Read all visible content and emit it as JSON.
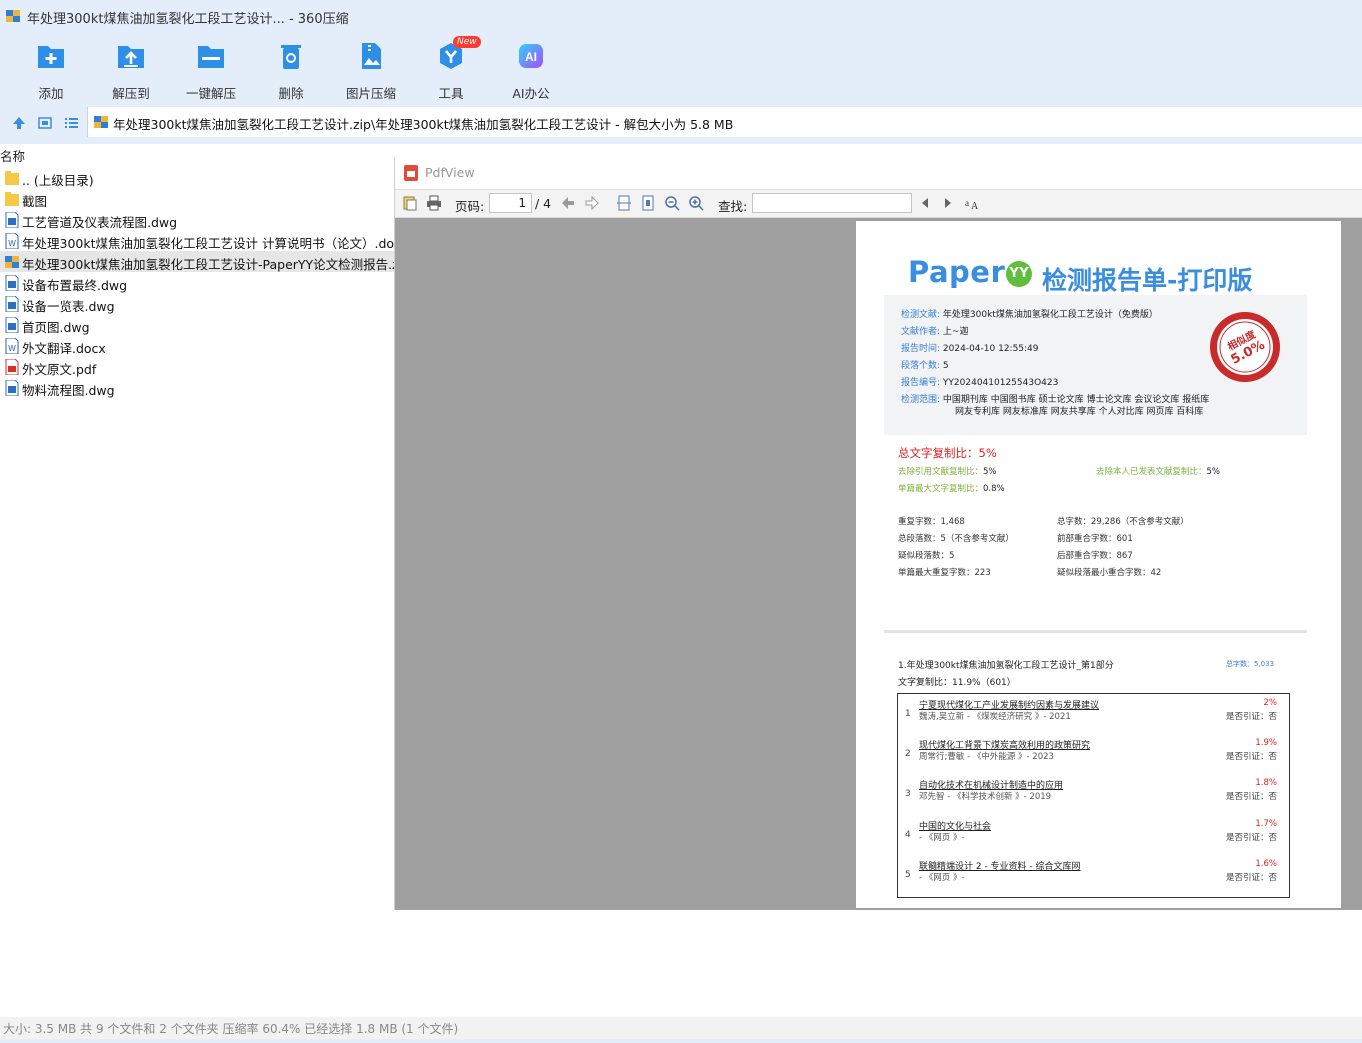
{
  "window": {
    "title": "年处理300kt煤焦油加氢裂化工段工艺设计... - 360压缩"
  },
  "toolbar": {
    "items": [
      {
        "label": "添加",
        "icon": "add-icon"
      },
      {
        "label": "解压到",
        "icon": "extract-to-icon"
      },
      {
        "label": "一键解压",
        "icon": "one-click-extract-icon"
      },
      {
        "label": "删除",
        "icon": "delete-icon"
      },
      {
        "label": "图片压缩",
        "icon": "image-compress-icon"
      },
      {
        "label": "工具",
        "icon": "tools-icon",
        "badge": "New"
      },
      {
        "label": "AI办公",
        "icon": "ai-office-icon"
      }
    ]
  },
  "address": {
    "path": "年处理300kt煤焦油加氢裂化工段工艺设计.zip\\年处理300kt煤焦油加氢裂化工段工艺设计 - 解包大小为 5.8 MB"
  },
  "filelist": {
    "column_name": "名称",
    "files": [
      {
        "name": ".. (上级目录)",
        "type": "folder"
      },
      {
        "name": "截图",
        "type": "folder"
      },
      {
        "name": "工艺管道及仪表流程图.dwg",
        "type": "dwg"
      },
      {
        "name": "年处理300kt煤焦油加氢裂化工段工艺设计 计算说明书（论文）.doc",
        "type": "doc"
      },
      {
        "name": "年处理300kt煤焦油加氢裂化工段工艺设计-PaperYY论文检测报告.zip",
        "type": "zip",
        "selected": true
      },
      {
        "name": "设备布置最终.dwg",
        "type": "dwg"
      },
      {
        "name": "设备一览表.dwg",
        "type": "dwg"
      },
      {
        "name": "首页图.dwg",
        "type": "dwg"
      },
      {
        "name": "外文翻译.docx",
        "type": "doc"
      },
      {
        "name": "外文原文.pdf",
        "type": "pdf"
      },
      {
        "name": "物料流程图.dwg",
        "type": "dwg"
      }
    ]
  },
  "pdfview": {
    "title": "PdfView",
    "page_label": "页码:",
    "page_current": "1",
    "page_total": "/ 4",
    "find_label": "查找:",
    "find_value": ""
  },
  "report": {
    "brand": "Paper",
    "brand_yy": "YY",
    "title": "检测报告单-打印版",
    "info": [
      {
        "k": "检测文献:",
        "v": "年处理300kt煤焦油加氢裂化工段工艺设计（免费版）"
      },
      {
        "k": "文献作者:",
        "v": "上~迦"
      },
      {
        "k": "报告时间:",
        "v": "2024-04-10 12:55:49"
      },
      {
        "k": "段落个数:",
        "v": "5"
      },
      {
        "k": "报告编号:",
        "v": "YY20240410125543O423"
      }
    ],
    "scope_label": "检测范围:",
    "scope_line1": "中国期刊库 中国图书库 硕士论文库 博士论文库 会议论文库 报纸库",
    "scope_line2": "网友专利库 网友标准库 网友共享库 个人对比库 网页库 百科库",
    "seal_text": "相似度",
    "seal_value": "5.0%",
    "total_rate": "总文字复制比：5%",
    "excl_ref_label": "去除引用文献复制比：",
    "excl_ref_val": "5%",
    "excl_self_label": "去除本人已发表文献复制比：",
    "excl_self_val": "5%",
    "max_label": "单篇最大文字复制比：",
    "max_val": "0.8%",
    "stats_left": [
      "重复字数：1,468",
      "总段落数：5（不含参考文献）",
      "疑似段落数：5",
      "单篇最大重复字数：223"
    ],
    "stats_right": [
      "总字数：29,286（不含参考文献）",
      "前部重合字数：601",
      "后部重合字数：867",
      "疑似段落最小重合字数：42"
    ],
    "part_title": "1.年处理300kt煤焦油加氢裂化工段工艺设计_第1部分",
    "part_count": "总字数：5,033",
    "part_rate": "文字复制比：11.9%（601）",
    "sources": [
      {
        "n": "1",
        "title": "宁夏现代煤化工产业发展制约因素与发展建议",
        "author": "魏涛,吴立新 - 《煤炭经济研究 》- 2021",
        "pct": "2%",
        "cite": "是否引证：否"
      },
      {
        "n": "2",
        "title": "现代煤化工背景下煤炭高效利用的政策研究",
        "author": "周常行;曹敏 - 《中外能源 》- 2023",
        "pct": "1.9%",
        "cite": "是否引证：否"
      },
      {
        "n": "3",
        "title": "自动化技术在机械设计制造中的应用",
        "author": "邓先智 - 《科学技术创新 》- 2019",
        "pct": "1.8%",
        "cite": "是否引证：否"
      },
      {
        "n": "4",
        "title": "中国的文化与社会",
        "author": "- 《网页 》-",
        "pct": "1.7%",
        "cite": "是否引证：否"
      },
      {
        "n": "5",
        "title": "联髓精端设计 2 - 专业资料 - 综合文库网",
        "author": "- 《网页 》-",
        "pct": "1.6%",
        "cite": "是否引证：否"
      }
    ]
  },
  "statusbar": {
    "text": "大小: 3.5 MB 共 9 个文件和 2 个文件夹 压缩率 60.4% 已经选择 1.8 MB (1 个文件)"
  },
  "colors": {
    "chrome": "#e4eefb",
    "accent": "#3a8ee0",
    "red": "#e02020",
    "green": "#7cb33c"
  }
}
